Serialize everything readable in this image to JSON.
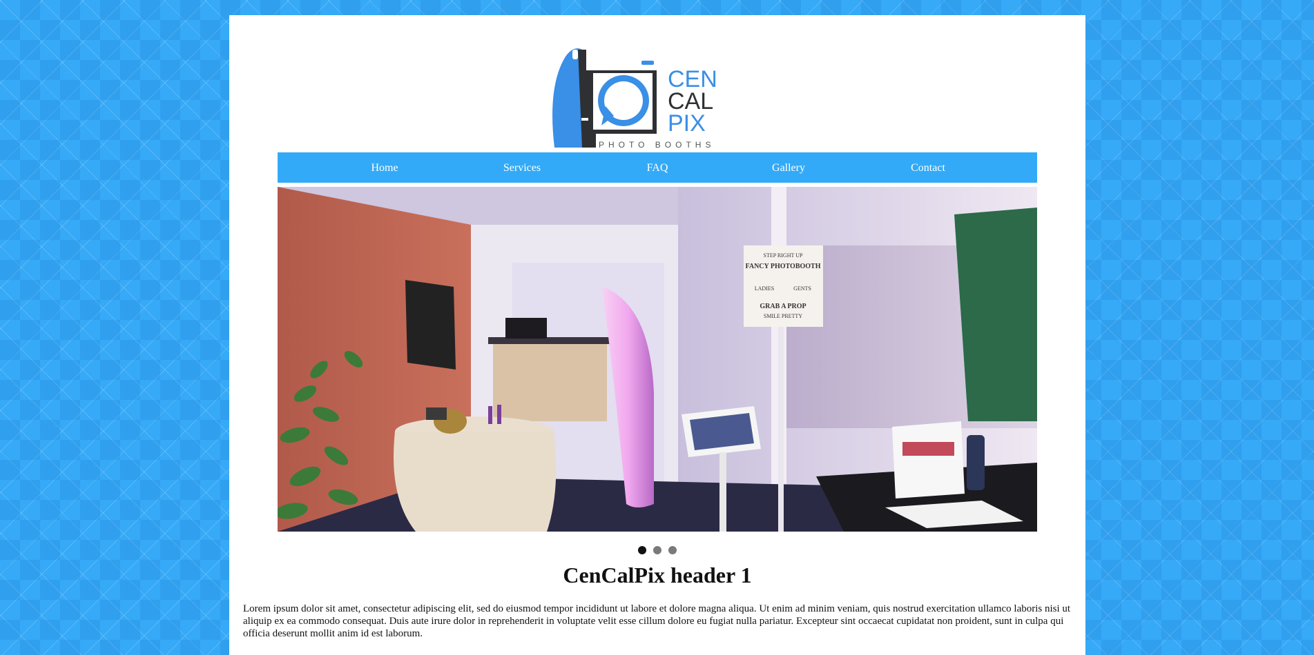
{
  "brand": {
    "logo_line1": "CEN",
    "logo_line2": "CAL",
    "logo_line3": "PIX",
    "logo_tagline": "PHOTO BOOTHS",
    "accent_color": "#36a9f7",
    "dark_color": "#2f3033"
  },
  "nav": {
    "items": [
      {
        "label": "Home"
      },
      {
        "label": "Services"
      },
      {
        "label": "FAQ"
      },
      {
        "label": "Gallery"
      },
      {
        "label": "Contact"
      }
    ]
  },
  "slider": {
    "slide_count": 3,
    "active_index": 0,
    "sign_text": [
      "STEP RIGHT UP",
      "FANCY PHOTOBOOTH",
      "LADIES",
      "GENTS",
      "GRAB A PROP",
      "SMILE PRETTY"
    ]
  },
  "content": {
    "heading": "CenCalPix header 1",
    "paragraph": "Lorem ipsum dolor sit amet, consectetur adipiscing elit, sed do eiusmod tempor incididunt ut labore et dolore magna aliqua. Ut enim ad minim veniam, quis nostrud exercitation ullamco laboris nisi ut aliquip ex ea commodo consequat. Duis aute irure dolor in reprehenderit in voluptate velit esse cillum dolore eu fugiat nulla pariatur. Excepteur sint occaecat cupidatat non proident, sunt in culpa qui officia deserunt mollit anim id est laborum."
  }
}
